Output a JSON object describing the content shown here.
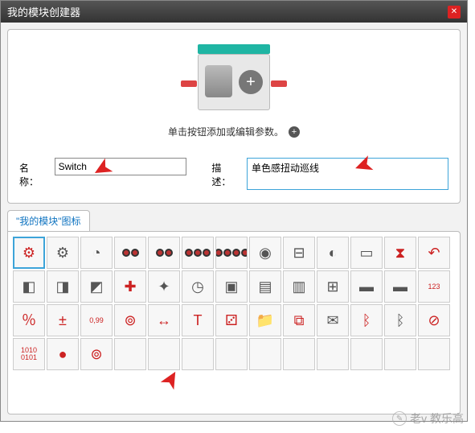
{
  "dialog": {
    "title": "我的模块创建器",
    "hint_text": "单击按钮添加或编辑参数。",
    "name_label": "名称：",
    "name_value": "Switch",
    "desc_label": "描述：",
    "desc_value": "单色感扭动巡线"
  },
  "tab": {
    "label": "\"我的模块\"图标"
  },
  "icons": [
    {
      "name": "brain-red",
      "glyph": "⚙",
      "cls": "ic-red",
      "selected": true
    },
    {
      "name": "brain-dark",
      "glyph": "⚙",
      "cls": "ic-dark"
    },
    {
      "name": "motor",
      "glyph": "◔",
      "cls": "ic-dark"
    },
    {
      "name": "wheel-2a",
      "glyph": "",
      "cls": "",
      "wheels": 2
    },
    {
      "name": "wheel-2b",
      "glyph": "",
      "cls": "",
      "wheels": 2
    },
    {
      "name": "wheel-3",
      "glyph": "",
      "cls": "",
      "wheels": 3
    },
    {
      "name": "wheel-4",
      "glyph": "",
      "cls": "",
      "wheels": 4
    },
    {
      "name": "gauge",
      "glyph": "◉",
      "cls": "ic-dark"
    },
    {
      "name": "slider",
      "glyph": "⊟",
      "cls": "ic-dark"
    },
    {
      "name": "speaker",
      "glyph": "◐",
      "cls": "ic-dark"
    },
    {
      "name": "display",
      "glyph": "▭",
      "cls": "ic-dark"
    },
    {
      "name": "hourglass",
      "glyph": "⧗",
      "cls": "ic-red"
    },
    {
      "name": "undo",
      "glyph": "↶",
      "cls": "ic-red"
    },
    {
      "name": "cube1",
      "glyph": "◧",
      "cls": "ic-dark"
    },
    {
      "name": "cube2",
      "glyph": "◨",
      "cls": "ic-dark"
    },
    {
      "name": "cube3",
      "glyph": "◩",
      "cls": "ic-dark"
    },
    {
      "name": "dpad",
      "glyph": "✚",
      "cls": "ic-red"
    },
    {
      "name": "axes",
      "glyph": "✦",
      "cls": "ic-dark"
    },
    {
      "name": "timer",
      "glyph": "◷",
      "cls": "ic-dark"
    },
    {
      "name": "sensor1",
      "glyph": "▣",
      "cls": "ic-dark"
    },
    {
      "name": "sensor2",
      "glyph": "▤",
      "cls": "ic-dark"
    },
    {
      "name": "sensor3",
      "glyph": "▥",
      "cls": "ic-dark"
    },
    {
      "name": "robot",
      "glyph": "⊞",
      "cls": "ic-dark"
    },
    {
      "name": "case1",
      "glyph": "▬",
      "cls": "ic-dark"
    },
    {
      "name": "case2",
      "glyph": "▬",
      "cls": "ic-dark"
    },
    {
      "name": "digits",
      "glyph": "123",
      "cls": "ic-red",
      "small": true
    },
    {
      "name": "percent",
      "glyph": "％",
      "cls": "ic-red"
    },
    {
      "name": "math",
      "glyph": "±",
      "cls": "ic-red"
    },
    {
      "name": "num",
      "glyph": "0,99",
      "cls": "ic-red",
      "small": true
    },
    {
      "name": "coil",
      "glyph": "⊚",
      "cls": "ic-red"
    },
    {
      "name": "width",
      "glyph": "↔",
      "cls": "ic-red"
    },
    {
      "name": "text",
      "glyph": "T",
      "cls": "ic-red"
    },
    {
      "name": "dice",
      "glyph": "⚂",
      "cls": "ic-red"
    },
    {
      "name": "folder",
      "glyph": "📁",
      "cls": "ic-red"
    },
    {
      "name": "chart",
      "glyph": "⧉",
      "cls": "ic-red"
    },
    {
      "name": "mail",
      "glyph": "✉",
      "cls": "ic-dark"
    },
    {
      "name": "bt-on",
      "glyph": "ᛒ",
      "cls": "ic-red"
    },
    {
      "name": "bt-off",
      "glyph": "ᛒ",
      "cls": "ic-dark"
    },
    {
      "name": "no-web",
      "glyph": "⊘",
      "cls": "ic-red"
    },
    {
      "name": "binary",
      "glyph": "1010\n0101",
      "cls": "ic-red",
      "small": true
    },
    {
      "name": "bug",
      "glyph": "●",
      "cls": "ic-red"
    },
    {
      "name": "spiral",
      "glyph": "⊚",
      "cls": "ic-red"
    }
  ],
  "watermark": {
    "text": "老v 教乐高"
  }
}
